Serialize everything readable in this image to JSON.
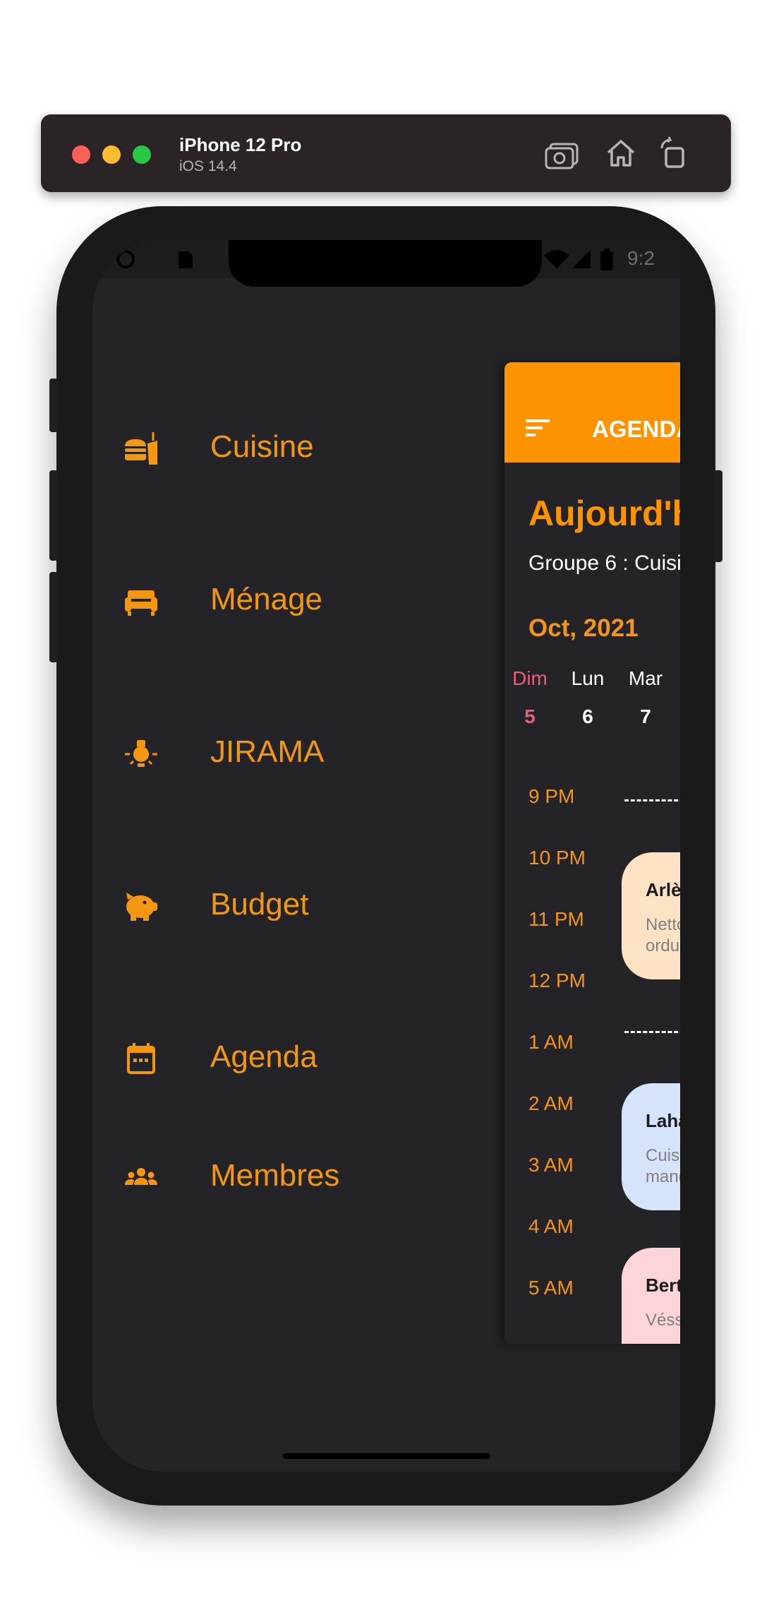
{
  "simulator": {
    "device_name": "iPhone 12 Pro",
    "os_version": "iOS 14.4",
    "icons": [
      "screenshot-icon",
      "home-icon",
      "rotate-icon"
    ]
  },
  "status_bar": {
    "time": "9:2"
  },
  "drawer": {
    "items": [
      {
        "label": "Cuisine",
        "icon": "food-icon"
      },
      {
        "label": "Ménage",
        "icon": "couch-icon"
      },
      {
        "label": "JIRAMA",
        "icon": "lightbulb-icon"
      },
      {
        "label": "Budget",
        "icon": "piggy-bank-icon"
      },
      {
        "label": "Agenda",
        "icon": "calendar-icon"
      },
      {
        "label": "Membres",
        "icon": "group-icon"
      }
    ]
  },
  "agenda": {
    "appbar_title": "AGENDA",
    "heading": "Aujourd'h",
    "group_line": "Groupe 6 : Cuisi",
    "month": "Oct, 2021",
    "days": [
      {
        "name": "Dim",
        "num": "5",
        "selected": true
      },
      {
        "name": "Lun",
        "num": "6",
        "selected": false
      },
      {
        "name": "Mar",
        "num": "7",
        "selected": false
      }
    ],
    "hours": [
      "9 PM",
      "10 PM",
      "11 PM",
      "12 PM",
      "1 AM",
      "2 AM",
      "3 AM",
      "4 AM",
      "5 AM"
    ],
    "events": [
      {
        "name": "Arlè",
        "desc1": "Netto",
        "desc2": "ordur",
        "color": "#fde3c4"
      },
      {
        "name": "Laha",
        "desc1": "Cuisi",
        "desc2": "mang",
        "color": "#d6e4fb"
      },
      {
        "name": "Bert",
        "desc1": "Véss",
        "desc2": "",
        "color": "#fdd5d9"
      }
    ]
  },
  "colors": {
    "accent": "#fd9301",
    "background": "#242428",
    "selected_day": "#e85d77"
  }
}
